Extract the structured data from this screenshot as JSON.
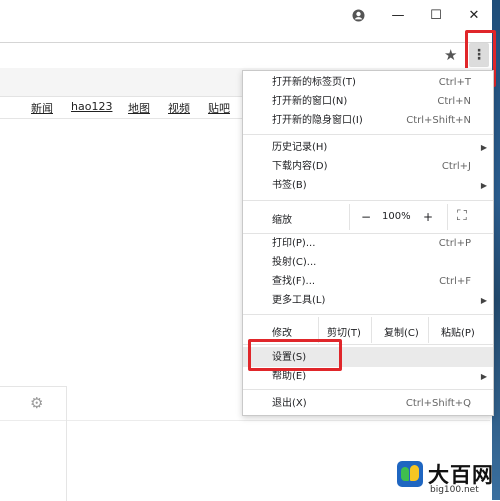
{
  "titlebar": {
    "account_icon": "account-circle-icon",
    "min_label": "—",
    "max_label": "☐",
    "close_label": "✕"
  },
  "toolbar": {
    "star_icon": "★",
    "menu_icon": "⋮"
  },
  "page": {
    "nav_links": [
      "新闻",
      "hao123",
      "地图",
      "视频",
      "贴吧"
    ]
  },
  "menu": {
    "group1": [
      {
        "label": "打开新的标签页(T)",
        "shortcut": "Ctrl+T"
      },
      {
        "label": "打开新的窗口(N)",
        "shortcut": "Ctrl+N"
      },
      {
        "label": "打开新的隐身窗口(I)",
        "shortcut": "Ctrl+Shift+N"
      }
    ],
    "group2": [
      {
        "label": "历史记录(H)",
        "shortcut": ""
      },
      {
        "label": "下载内容(D)",
        "shortcut": "Ctrl+J"
      },
      {
        "label": "书签(B)",
        "shortcut": ""
      }
    ],
    "zoom": {
      "label": "缩放",
      "minus": "−",
      "value": "100%",
      "plus": "+",
      "fullscreen": "⛶"
    },
    "group3": [
      {
        "label": "打印(P)...",
        "shortcut": "Ctrl+P"
      },
      {
        "label": "投射(C)...",
        "shortcut": ""
      },
      {
        "label": "查找(F)...",
        "shortcut": "Ctrl+F"
      },
      {
        "label": "更多工具(L)",
        "shortcut": ""
      }
    ],
    "edit": {
      "label": "修改",
      "cut": "剪切(T)",
      "copy": "复制(C)",
      "paste": "粘贴(P)"
    },
    "settings": "设置(S)",
    "help": "帮助(E)",
    "exit": {
      "label": "退出(X)",
      "shortcut": "Ctrl+Shift+Q"
    },
    "submenu_arrow": "▶"
  },
  "watermark": {
    "title": "大百网",
    "url": "big100.net"
  },
  "colors": {
    "highlight": "#e0262a",
    "menu_hover": "#eaeaea"
  }
}
